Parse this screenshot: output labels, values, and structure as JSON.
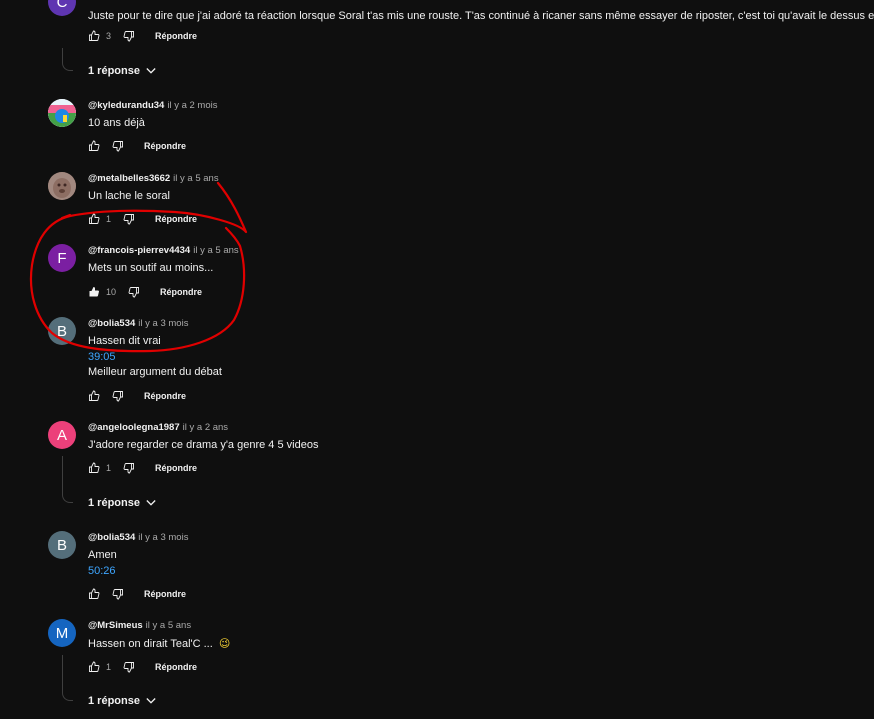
{
  "colors": {
    "background": "#0f0f0f",
    "link": "#3ea6ff",
    "annotation": "#e00000"
  },
  "reply_label": "Répondre",
  "comments": [
    {
      "avatar_letter": "C",
      "avatar_color": "#5e35b1",
      "text": "Juste pour te dire que j'ai adoré ta réaction lorsque Soral t'as mis une rouste. T'as continué à ricaner sans même essayer de riposter, c'est toi qu'avait le dessus en fa",
      "likes": "3",
      "replies_label": "1 réponse"
    },
    {
      "author": "@kyledurandu34",
      "time": "il y a 2 mois",
      "avatar_icon": "landscape-avatar",
      "text": "10 ans déjà",
      "likes": ""
    },
    {
      "author": "@metalbelles3662",
      "time": "il y a 5 ans",
      "avatar_icon": "animal-photo-avatar",
      "text": "Un lache le soral",
      "likes": "1"
    },
    {
      "author": "@francois-pierrev4434",
      "time": "il y a 5 ans",
      "avatar_letter": "F",
      "avatar_color": "#7b1fa2",
      "text": "Mets un soutif au moins...",
      "likes": "10",
      "liked": true
    },
    {
      "author": "@bolia534",
      "time": "il y a 3 mois",
      "avatar_letter": "B",
      "avatar_color": "#546e7a",
      "text": "Hassen dit vrai",
      "timestamp": "39:05",
      "text2": "Meilleur argument du débat",
      "likes": ""
    },
    {
      "author": "@angeloolegna1987",
      "time": "il y a 2 ans",
      "avatar_letter": "A",
      "avatar_color": "#ec407a",
      "text": "J'adore regarder ce drama y'a genre 4 5 videos",
      "likes": "1",
      "replies_label": "1 réponse"
    },
    {
      "author": "@bolia534",
      "time": "il y a 3 mois",
      "avatar_letter": "B",
      "avatar_color": "#546e7a",
      "text": "Amen",
      "timestamp": "50:26",
      "likes": ""
    },
    {
      "author": "@MrSimeus",
      "time": "il y a 5 ans",
      "avatar_letter": "M",
      "avatar_color": "#1565c0",
      "text": "Hassen on dirait Teal'C ...",
      "emoji": "😉",
      "likes": "1",
      "replies_label": "1 réponse"
    }
  ]
}
